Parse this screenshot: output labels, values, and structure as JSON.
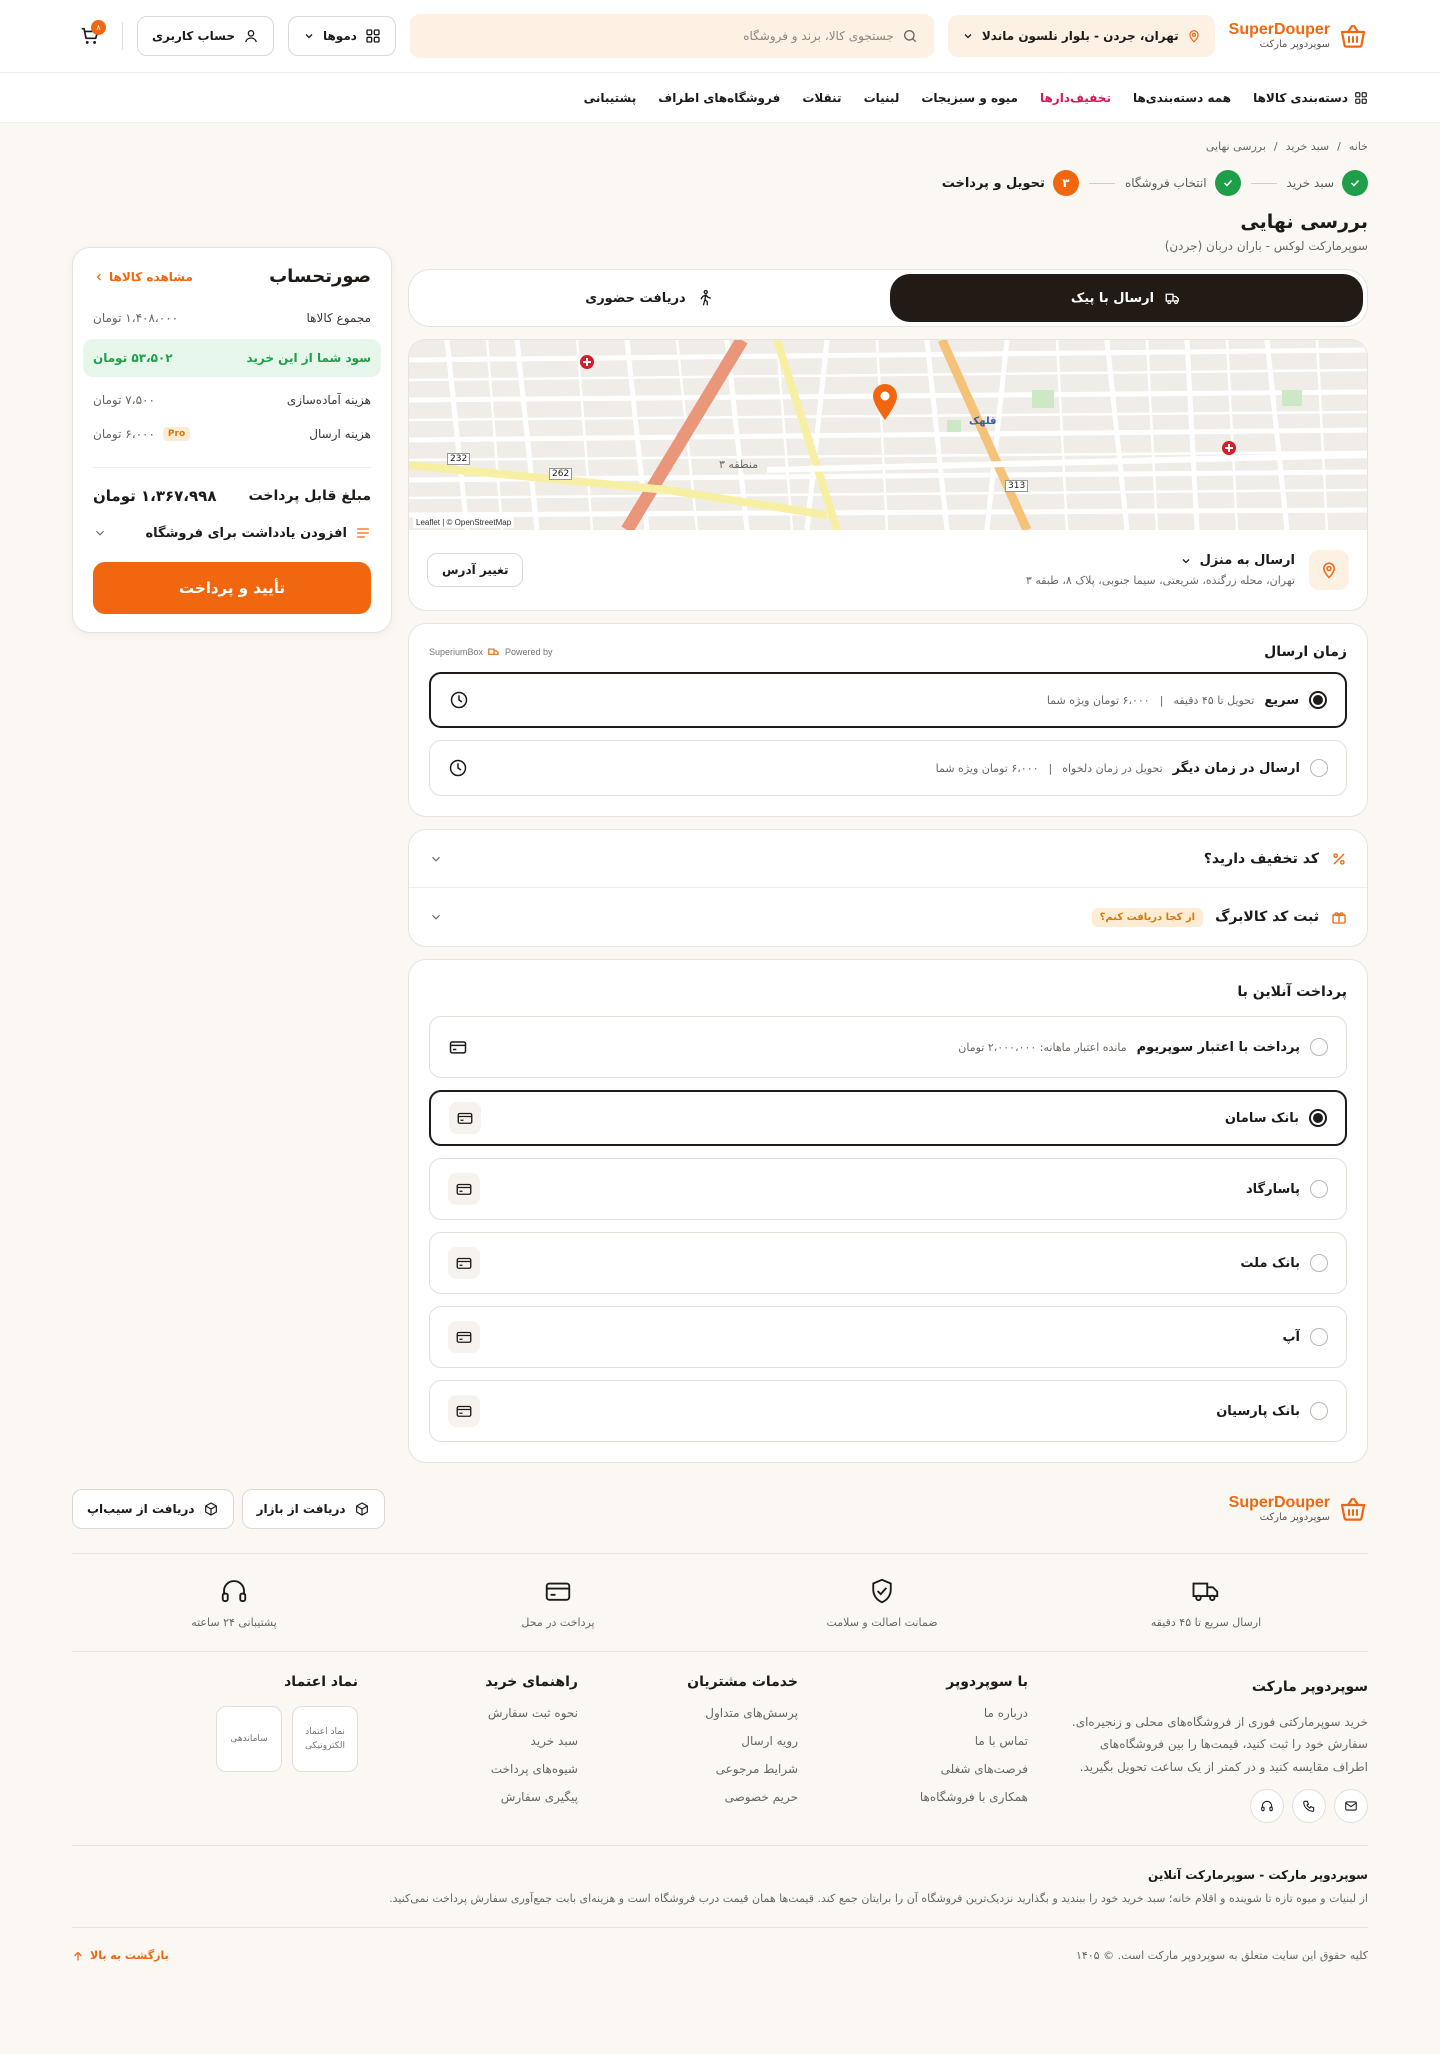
{
  "brand": {
    "name_en": "SuperDouper",
    "name_fa": "سوپردوپر مارکت",
    "accent": "#f0670f"
  },
  "header": {
    "location": "تهران، جردن - بلوار نلسون ماندلا",
    "search_placeholder": "جستجوی کالا، برند و فروشگاه",
    "demos_label": "دموها",
    "account_label": "حساب کاربری",
    "cart_count": "۸"
  },
  "nav": {
    "categories_label": "دسته‌بندی کالاها",
    "items": [
      "همه دسته‌بندی‌ها",
      "تخفیف‌دارها",
      "میوه و سبزیجات",
      "لبنیات",
      "تنقلات",
      "فروشگاه‌های اطراف",
      "پشتیبانی"
    ]
  },
  "breadcrumb": [
    "خانه",
    "سبد خرید",
    "بررسی نهایی"
  ],
  "steps": [
    {
      "num": "",
      "label": "سبد خرید",
      "state": "done"
    },
    {
      "num": "",
      "label": "انتخاب فروشگاه",
      "state": "done"
    },
    {
      "num": "۳",
      "label": "تحویل و پرداخت",
      "state": "current"
    }
  ],
  "page": {
    "title": "بررسی نهایی",
    "subtitle": "سوپرمارکت لوکس - باران دربان (جردن)"
  },
  "delivery_tabs": [
    {
      "label": "ارسال با پیک",
      "active": true
    },
    {
      "label": "دریافت حضوری",
      "active": false
    }
  ],
  "map": {
    "labels": [
      "قلهک",
      "232",
      "262",
      "313",
      "منطقه ۳"
    ],
    "attribution": "Leaflet | © OpenStreetMap"
  },
  "address": {
    "title": "ارسال به منزل",
    "line": "تهران، محله زرگنده، شریعتی، سیما جنوبی، پلاک ۸، طبقه ۳",
    "change_label": "تغییر آدرس"
  },
  "delivery_time": {
    "title": "زمان ارسال",
    "powered": "Powered by",
    "partner": "SuperiumBox",
    "options": [
      {
        "title": "سریع",
        "desc": "تحویل تا ۴۵ دقیقه",
        "price": "۶،۰۰۰ تومان ویژه شما",
        "selected": true
      },
      {
        "title": "ارسال در زمان دیگر",
        "desc": "تحویل در زمان دلخواه",
        "price": "۶،۰۰۰ تومان ویژه شما",
        "selected": false
      }
    ]
  },
  "discount": {
    "label": "کد تخفیف دارید؟"
  },
  "gift": {
    "label": "ثبت کد کالابرگ",
    "tag": "از کجا دریافت کنم؟"
  },
  "payment": {
    "title": "پرداخت آنلاین با",
    "credit": {
      "title": "پرداخت با اعتبار سوپریوم",
      "desc": "مانده اعتبار ماهانه: ۲،۰۰۰،۰۰۰ تومان",
      "selected": false
    },
    "banks": [
      {
        "title": "بانک سامان",
        "selected": true
      },
      {
        "title": "پاسارگاد",
        "selected": false
      },
      {
        "title": "بانک ملت",
        "selected": false
      },
      {
        "title": "آپ",
        "selected": false
      },
      {
        "title": "بانک پارسیان",
        "selected": false
      }
    ]
  },
  "summary": {
    "title": "صورتحساب",
    "view_items": "مشاهده کالاها",
    "items_total_label": "مجموع کالاها",
    "items_total": "۱،۴۰۸،۰۰۰ تومان",
    "profit_label": "سود شما از این خرید",
    "profit": "۵۳،۵۰۲ تومان",
    "prep_label": "هزینه آماده‌سازی",
    "prep": "۷،۵۰۰ تومان",
    "shipping_label": "هزینه ارسال",
    "shipping": "۶،۰۰۰ تومان",
    "pro_badge": "Pro",
    "payable_label": "مبلغ قابل پرداخت",
    "payable": "۱،۳۶۷،۹۹۸ تومان",
    "note_label": "افزودن یادداشت برای فروشگاه",
    "cta": "تأیید و پرداخت"
  },
  "footer": {
    "app_buttons": [
      "دریافت از بازار",
      "دریافت از سیب‌اپ"
    ],
    "features": [
      "ارسال سریع تا ۴۵ دقیقه",
      "ضمانت اصالت و سلامت",
      "پرداخت در محل",
      "پشتیبانی ۲۴ ساعته"
    ],
    "about_title": "سوپردوپر مارکت",
    "about_text": "خرید سوپرمارکتی فوری از فروشگاه‌های محلی و زنجیره‌ای. سفارش خود را ثبت کنید، قیمت‌ها را بین فروشگاه‌های اطراف مقایسه کنید و در کمتر از یک ساعت تحویل بگیرید.",
    "columns": [
      {
        "title": "با سوپردوپر",
        "links": [
          "درباره ما",
          "تماس با ما",
          "فرصت‌های شغلی",
          "همکاری با فروشگاه‌ها"
        ]
      },
      {
        "title": "خدمات مشتریان",
        "links": [
          "پرسش‌های متداول",
          "رویه ارسال",
          "شرایط مرجوعی",
          "حریم خصوصی"
        ]
      },
      {
        "title": "راهنمای خرید",
        "links": [
          "نحوه ثبت سفارش",
          "سبد خرید",
          "شیوه‌های پرداخت",
          "پیگیری سفارش"
        ]
      }
    ],
    "trust_title": "نماد اعتماد",
    "trust_items": [
      "نماد اعتماد الکترونیکی",
      "ساماندهی"
    ],
    "seo_title": "سوپردوپر مارکت - سوپرمارکت آنلاین",
    "seo_text": "از لبنیات و میوه تازه تا شوینده و اقلام خانه؛ سبد خرید خود را ببندید و بگذارید نزدیک‌ترین فروشگاه آن را برایتان جمع کند. قیمت‌ها همان قیمت درب فروشگاه است و هزینه‌ای بابت جمع‌آوری سفارش پرداخت نمی‌کنید.",
    "copyright": "کلیه حقوق این سایت متعلق به سوپردوپر مارکت است. © ۱۴۰۵",
    "back_to_top": "بازگشت به بالا"
  }
}
